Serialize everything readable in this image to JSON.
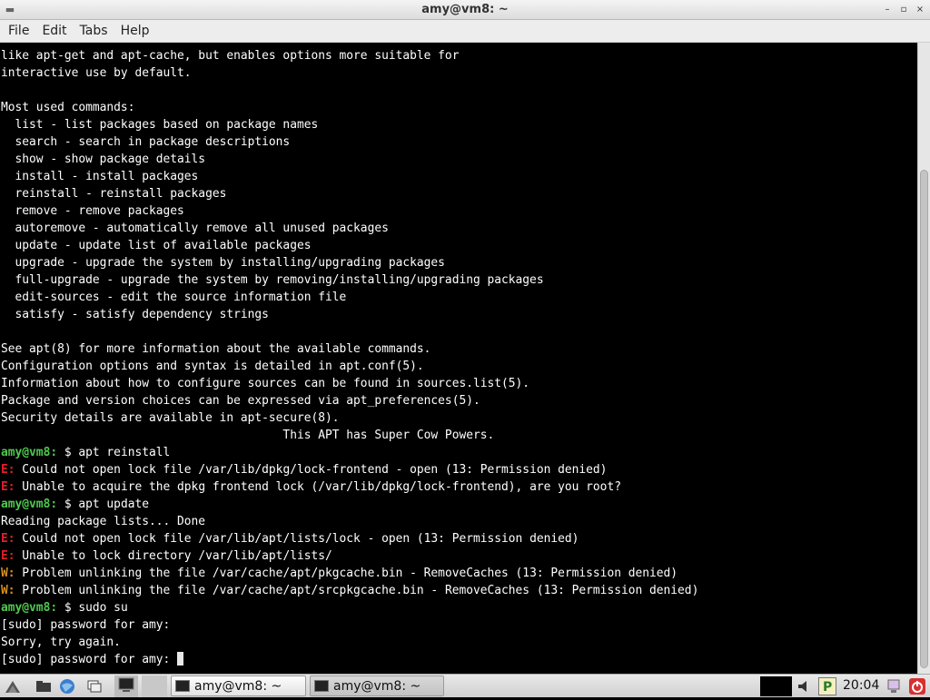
{
  "window": {
    "title": "amy@vm8: ~",
    "controls": {
      "minimize": "–",
      "maximize": "▫",
      "close": "×"
    }
  },
  "menubar": {
    "items": [
      "File",
      "Edit",
      "Tabs",
      "Help"
    ]
  },
  "terminal": {
    "prompt": "amy@vm8:",
    "lines": [
      {
        "type": "text",
        "text": "like apt-get and apt-cache, but enables options more suitable for"
      },
      {
        "type": "text",
        "text": "interactive use by default."
      },
      {
        "type": "text",
        "text": ""
      },
      {
        "type": "text",
        "text": "Most used commands:"
      },
      {
        "type": "text",
        "text": "  list - list packages based on package names"
      },
      {
        "type": "text",
        "text": "  search - search in package descriptions"
      },
      {
        "type": "text",
        "text": "  show - show package details"
      },
      {
        "type": "text",
        "text": "  install - install packages"
      },
      {
        "type": "text",
        "text": "  reinstall - reinstall packages"
      },
      {
        "type": "text",
        "text": "  remove - remove packages"
      },
      {
        "type": "text",
        "text": "  autoremove - automatically remove all unused packages"
      },
      {
        "type": "text",
        "text": "  update - update list of available packages"
      },
      {
        "type": "text",
        "text": "  upgrade - upgrade the system by installing/upgrading packages"
      },
      {
        "type": "text",
        "text": "  full-upgrade - upgrade the system by removing/installing/upgrading packages"
      },
      {
        "type": "text",
        "text": "  edit-sources - edit the source information file"
      },
      {
        "type": "text",
        "text": "  satisfy - satisfy dependency strings"
      },
      {
        "type": "text",
        "text": ""
      },
      {
        "type": "text",
        "text": "See apt(8) for more information about the available commands."
      },
      {
        "type": "text",
        "text": "Configuration options and syntax is detailed in apt.conf(5)."
      },
      {
        "type": "text",
        "text": "Information about how to configure sources can be found in sources.list(5)."
      },
      {
        "type": "text",
        "text": "Package and version choices can be expressed via apt_preferences(5)."
      },
      {
        "type": "text",
        "text": "Security details are available in apt-secure(8)."
      },
      {
        "type": "text",
        "text": "                                        This APT has Super Cow Powers."
      },
      {
        "type": "prompt",
        "text": " $ apt reinstall"
      },
      {
        "type": "error",
        "prefix": "E:",
        "text": " Could not open lock file /var/lib/dpkg/lock-frontend - open (13: Permission denied)"
      },
      {
        "type": "error",
        "prefix": "E:",
        "text": " Unable to acquire the dpkg frontend lock (/var/lib/dpkg/lock-frontend), are you root?"
      },
      {
        "type": "prompt",
        "text": " $ apt update"
      },
      {
        "type": "text",
        "text": "Reading package lists... Done"
      },
      {
        "type": "error",
        "prefix": "E:",
        "text": " Could not open lock file /var/lib/apt/lists/lock - open (13: Permission denied)"
      },
      {
        "type": "error",
        "prefix": "E:",
        "text": " Unable to lock directory /var/lib/apt/lists/"
      },
      {
        "type": "warn",
        "prefix": "W:",
        "text": " Problem unlinking the file /var/cache/apt/pkgcache.bin - RemoveCaches (13: Permission denied)"
      },
      {
        "type": "warn",
        "prefix": "W:",
        "text": " Problem unlinking the file /var/cache/apt/srcpkgcache.bin - RemoveCaches (13: Permission denied)"
      },
      {
        "type": "prompt",
        "text": " $ sudo su"
      },
      {
        "type": "text",
        "text": "[sudo] password for amy:"
      },
      {
        "type": "text",
        "text": "Sorry, try again."
      },
      {
        "type": "input",
        "text": "[sudo] password for amy: "
      }
    ]
  },
  "taskbar": {
    "launchers": [
      "start-menu-icon",
      "file-manager-icon",
      "web-browser-icon",
      "window-switcher-icon",
      "terminal-icon"
    ],
    "tasks": [
      {
        "label": "amy@vm8: ~",
        "active": true
      },
      {
        "label": "amy@vm8: ~",
        "active": false
      }
    ],
    "tray": [
      "volume-icon",
      "package-updater-icon",
      "lock-screen-icon",
      "power-icon"
    ],
    "clock": "20:04"
  },
  "colors": {
    "prompt": "#4ec94e",
    "error": "#e0202a",
    "warning": "#d8901e",
    "background": "#000000",
    "foreground": "#ffffff"
  }
}
